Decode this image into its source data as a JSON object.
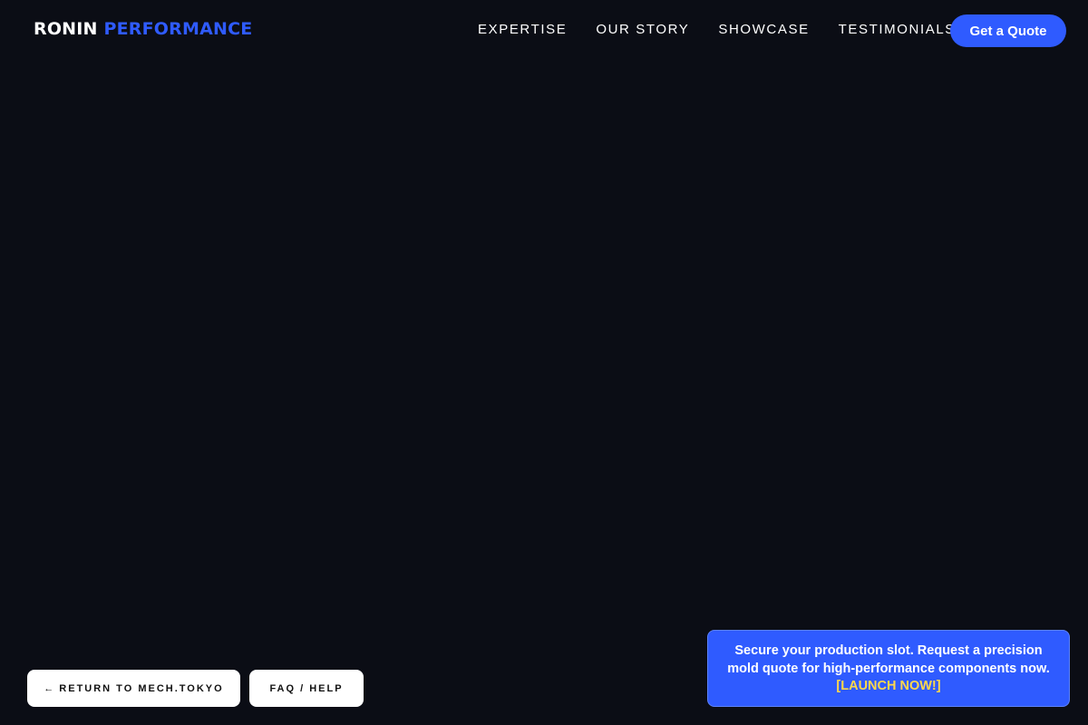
{
  "header": {
    "logo_brand": "RONIN",
    "logo_accent": "PERFORMANCE",
    "nav": [
      {
        "label": "EXPERTISE"
      },
      {
        "label": "OUR STORY"
      },
      {
        "label": "SHOWCASE"
      },
      {
        "label": "TESTIMONIALS"
      }
    ],
    "cta_label": "Get a Quote"
  },
  "footer_links": {
    "return_arrow": "←",
    "return_label": "RETURN TO MECH.TOKYO",
    "faq_label": "FAQ / HELP"
  },
  "promo": {
    "message": "Secure your production slot. Request a precision mold quote for high-performance components now.",
    "cta": "[LAUNCH NOW!]"
  },
  "colors": {
    "background": "#0b0d15",
    "accent": "#2f5bff",
    "cta_highlight": "#ffd84a"
  }
}
